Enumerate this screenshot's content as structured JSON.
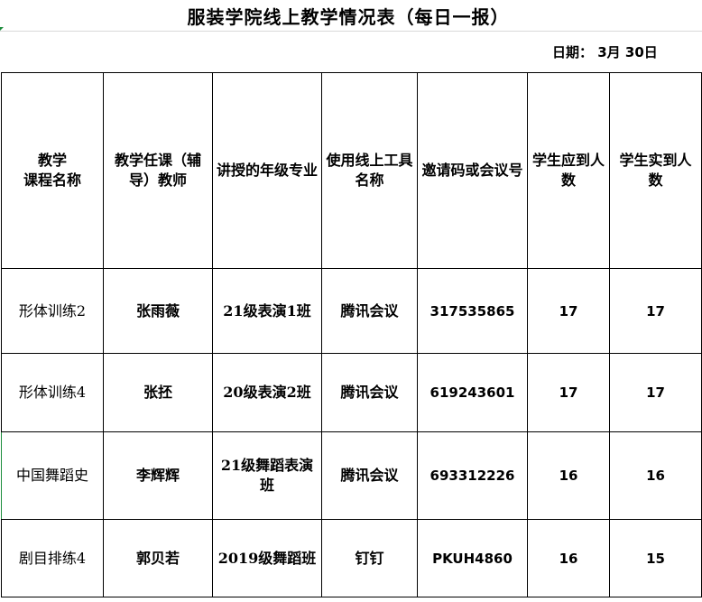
{
  "title": "服装学院线上教学情况表（每日一报）",
  "date_label": "日期：  3月  30日",
  "headers": [
    "教学\n课程名称",
    "教学任课（辅导）教师",
    "讲授的年级专业",
    "使用线上工具名称",
    "邀请码或会议号",
    "学生应到人数",
    "学生实到人数"
  ],
  "rows": [
    {
      "course": "形体训练2",
      "teacher": "张雨薇",
      "class": "21级表演1班",
      "tool": "腾讯会议",
      "code": "317535865",
      "expected": "17",
      "actual": "17"
    },
    {
      "course": "形体训练4",
      "teacher": "张抷",
      "class": "20级表演2班",
      "tool": "腾讯会议",
      "code": "619243601",
      "expected": "17",
      "actual": "17"
    },
    {
      "course": "中国舞蹈史",
      "teacher": "李辉辉",
      "class": "21级舞蹈表演班",
      "tool": "腾讯会议",
      "code": "693312226",
      "expected": "16",
      "actual": "16"
    },
    {
      "course": "剧目排练4",
      "teacher": "郭贝若",
      "class": "2019级舞蹈班",
      "tool": "钉钉",
      "code": "PKUH4860",
      "expected": "16",
      "actual": "15"
    }
  ]
}
